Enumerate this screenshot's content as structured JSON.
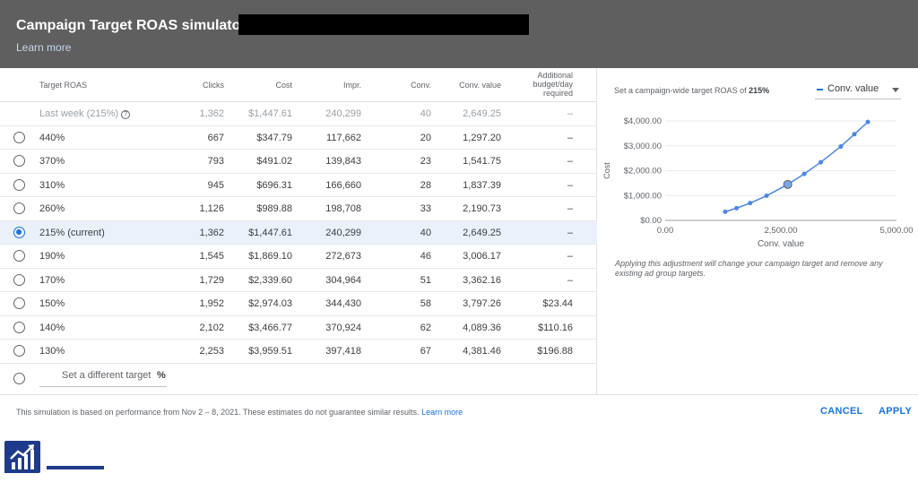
{
  "header": {
    "title": "Campaign Target ROAS simulator:",
    "learn_more": "Learn more"
  },
  "table": {
    "headers": {
      "target_roas": "Target ROAS",
      "clicks": "Clicks",
      "cost": "Cost",
      "impr": "Impr.",
      "conv": "Conv.",
      "conv_value": "Conv. value",
      "additional": [
        "Additional",
        "budget/day",
        "required"
      ]
    },
    "last_week": {
      "label": "Last week (215%)",
      "clicks": "1,362",
      "cost": "$1,447.61",
      "impr": "240,299",
      "conv": "40",
      "conv_value": "2,649.25",
      "additional": "–"
    },
    "rows": [
      {
        "label": "440%",
        "clicks": "667",
        "cost": "$347.79",
        "impr": "117,662",
        "conv": "20",
        "conv_value": "1,297.20",
        "additional": "–",
        "selected": false
      },
      {
        "label": "370%",
        "clicks": "793",
        "cost": "$491.02",
        "impr": "139,843",
        "conv": "23",
        "conv_value": "1,541.75",
        "additional": "–",
        "selected": false
      },
      {
        "label": "310%",
        "clicks": "945",
        "cost": "$696.31",
        "impr": "166,660",
        "conv": "28",
        "conv_value": "1,837.39",
        "additional": "–",
        "selected": false
      },
      {
        "label": "260%",
        "clicks": "1,126",
        "cost": "$989.88",
        "impr": "198,708",
        "conv": "33",
        "conv_value": "2,190.73",
        "additional": "–",
        "selected": false
      },
      {
        "label": "215% (current)",
        "clicks": "1,362",
        "cost": "$1,447.61",
        "impr": "240,299",
        "conv": "40",
        "conv_value": "2,649.25",
        "additional": "–",
        "selected": true
      },
      {
        "label": "190%",
        "clicks": "1,545",
        "cost": "$1,869.10",
        "impr": "272,673",
        "conv": "46",
        "conv_value": "3,006.17",
        "additional": "–",
        "selected": false
      },
      {
        "label": "170%",
        "clicks": "1,729",
        "cost": "$2,339.60",
        "impr": "304,964",
        "conv": "51",
        "conv_value": "3,362.16",
        "additional": "–",
        "selected": false
      },
      {
        "label": "150%",
        "clicks": "1,952",
        "cost": "$2,974.03",
        "impr": "344,430",
        "conv": "58",
        "conv_value": "3,797.26",
        "additional": "$23.44",
        "selected": false
      },
      {
        "label": "140%",
        "clicks": "2,102",
        "cost": "$3,466.77",
        "impr": "370,924",
        "conv": "62",
        "conv_value": "4,089.36",
        "additional": "$110.16",
        "selected": false
      },
      {
        "label": "130%",
        "clicks": "2,253",
        "cost": "$3,959.51",
        "impr": "397,418",
        "conv": "67",
        "conv_value": "4,381.46",
        "additional": "$196.88",
        "selected": false
      }
    ],
    "custom_target": {
      "placeholder": "Set a different target",
      "suffix": "%"
    }
  },
  "chart_panel": {
    "caption_prefix": "Set a campaign-wide target ROAS of",
    "caption_value": "215%",
    "metric_select": "Conv. value",
    "note": "Applying this adjustment will change your campaign target and remove any existing ad group targets."
  },
  "chart_data": {
    "type": "line",
    "xlabel": "Conv. value",
    "ylabel": "Cost",
    "xlim": [
      0,
      5000
    ],
    "ylim": [
      0,
      4000
    ],
    "xticks": [
      "0.00",
      "2,500.00",
      "5,000.00"
    ],
    "yticks": [
      "$0.00",
      "$1,000.00",
      "$2,000.00",
      "$3,000.00",
      "$4,000.00"
    ],
    "series": [
      {
        "x": [
          1297.2,
          1541.75,
          1837.39,
          2190.73,
          2649.25,
          3006.17,
          3362.16,
          3797.26,
          4089.36,
          4381.46
        ],
        "y": [
          347.79,
          491.02,
          696.31,
          989.88,
          1447.61,
          1869.1,
          2339.6,
          2974.03,
          3466.77,
          3959.51
        ],
        "highlight_index": 4
      }
    ],
    "color": "#4a86e8"
  },
  "footer": {
    "text": "This simulation is based on performance from Nov 2 – 8, 2021. These estimates do not guarantee similar results.",
    "link": "Learn more",
    "cancel": "CANCEL",
    "apply": "APPLY"
  }
}
